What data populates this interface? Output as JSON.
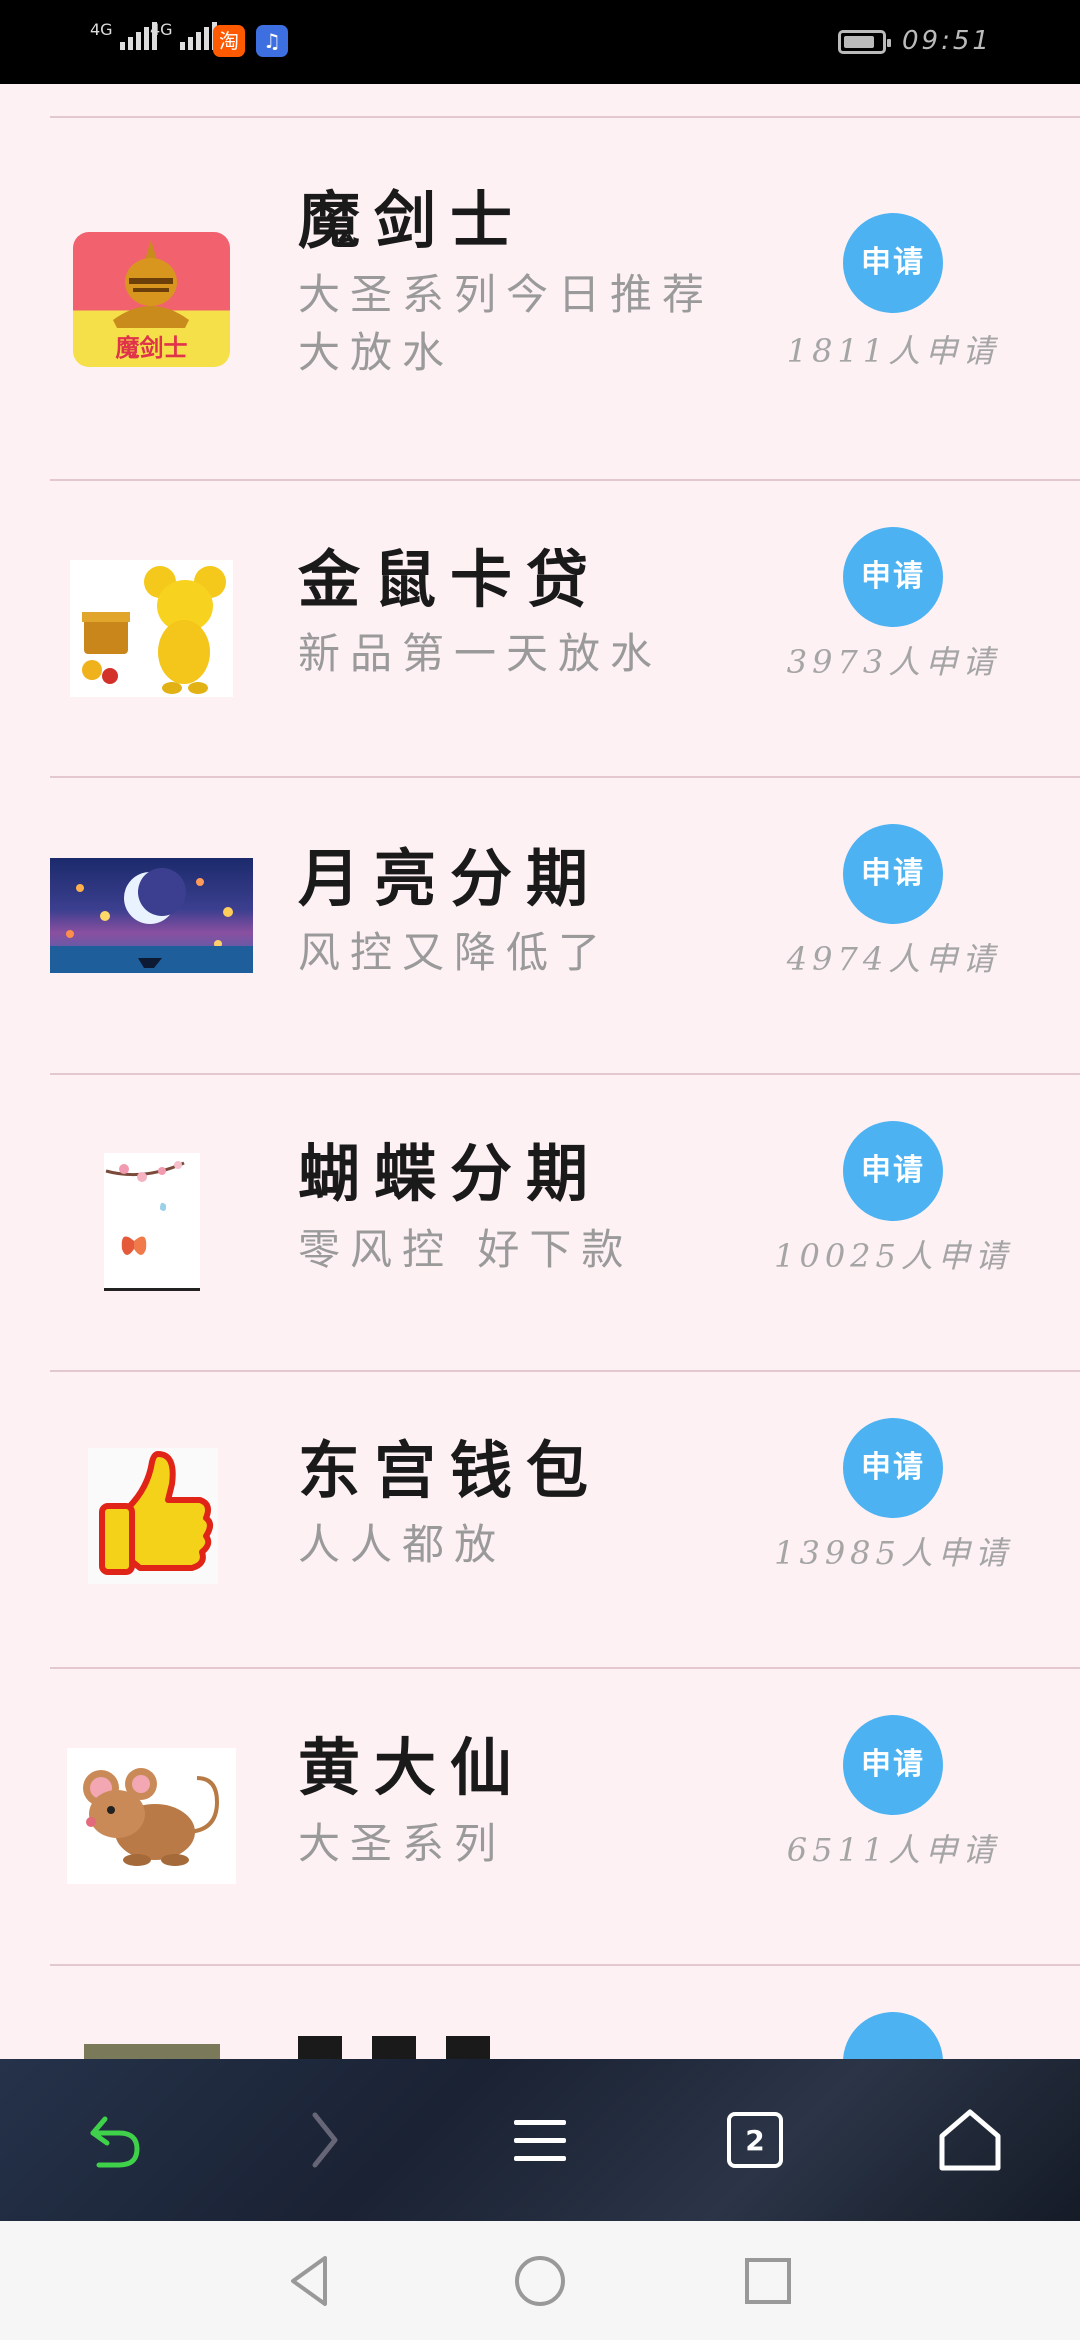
{
  "status_bar": {
    "signal1_label": "4G",
    "signal2_label": "4G",
    "app_icons": [
      {
        "name": "taobao-icon",
        "glyph": "淘",
        "color": "#ff5a00"
      },
      {
        "name": "music-icon",
        "glyph": "♫",
        "color": "#3d6fe0"
      }
    ],
    "time": "09:51"
  },
  "products": [
    {
      "title": "魔剑士",
      "desc": "大圣系列今日推荐大放水",
      "button": "申请",
      "count": "1811人申请",
      "thumb": "knight-logo",
      "thumb_text": "魔剑士"
    },
    {
      "title": "金鼠卡贷",
      "desc": "新品第一天放水",
      "button": "申请",
      "count": "3973人申请",
      "thumb": "golden-mouse"
    },
    {
      "title": "月亮分期",
      "desc": "风控又降低了",
      "button": "申请",
      "count": "4974人申请",
      "thumb": "moon-night"
    },
    {
      "title": "蝴蝶分期",
      "desc": "零风控  好下款",
      "button": "申请",
      "count": "10025人申请",
      "thumb": "butterfly-blossom"
    },
    {
      "title": "东宫钱包",
      "desc": "人人都放",
      "button": "申请",
      "count": "13985人申请",
      "thumb": "thumbs-up"
    },
    {
      "title": "黄大仙",
      "desc": "大圣系列",
      "button": "申请",
      "count": "6511人申请",
      "thumb": "cartoon-mouse"
    },
    {
      "title": "",
      "desc": "",
      "button": "",
      "count": "",
      "thumb": "partial"
    }
  ],
  "browser_toolbar": {
    "tab_count": "2",
    "icons": [
      "back-icon",
      "forward-icon",
      "menu-icon",
      "tabs-icon",
      "home-icon"
    ]
  },
  "nav_bar": {
    "icons": [
      "nav-back-icon",
      "nav-home-icon",
      "nav-recents-icon"
    ]
  },
  "colors": {
    "background": "#fdf1f4",
    "apply_button": "#4db2f1",
    "divider": "#e4c8cf",
    "title": "#1a1a1a",
    "description": "#9a9a9a"
  }
}
